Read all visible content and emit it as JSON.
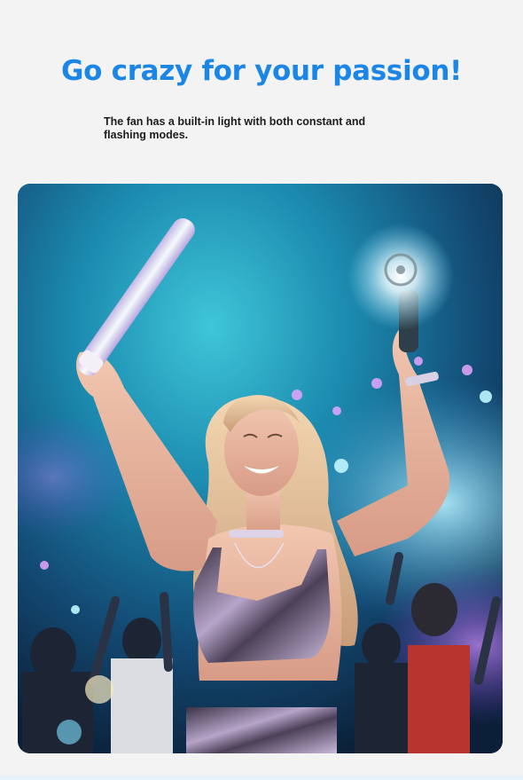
{
  "headline": "Go crazy for your passion!",
  "subtext": "The fan has a built-in light with both constant and flashing modes.",
  "colors": {
    "headline": "#1b86e6",
    "subtext": "#1c1c1c",
    "page_background": "#f3f3f3"
  }
}
